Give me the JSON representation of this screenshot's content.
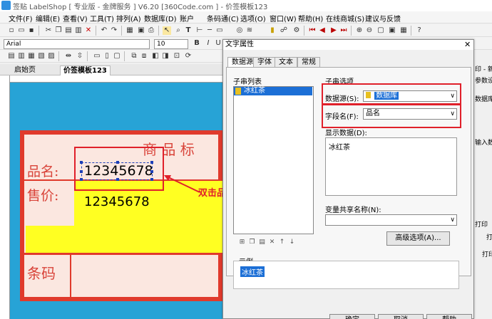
{
  "window": {
    "title": "签贴 LabelShop [ 专业版 - 金牌服务 ]  V6.20  [360Code.com ]  - 价签模板123"
  },
  "menu": [
    "文件(F)",
    "编辑(E)",
    "查看(V)",
    "工具(T)",
    "排列(A)",
    "数据库(D)",
    "账户",
    "条码通(C)",
    "选项(O)",
    "窗口(W)",
    "帮助(H)",
    "在线商城(S)",
    "建议与反馈"
  ],
  "font_toolbar": {
    "font": "Arial",
    "size": "10"
  },
  "tabs": [
    "启始页",
    "价签模板123"
  ],
  "label": {
    "title_text": "商 品 标",
    "name_label": "品名:",
    "price_label": "售价:",
    "barcode_label": "条码",
    "name_value": "12345678",
    "price_value": "12345678"
  },
  "annotation": {
    "double_click": "双击品名"
  },
  "right_panel": {
    "t1": "印 - 新",
    "t2": "参数设",
    "t3": "数据库",
    "t4": "输入数",
    "t5": "打印",
    "t6": "打",
    "t7": "打印"
  },
  "dialog": {
    "title": "文字属性",
    "tabs": [
      "数据源",
      "字体",
      "文本",
      "常规"
    ],
    "list_label": "子串列表",
    "list_items": [
      "冰红茶"
    ],
    "options_label": "子串选项",
    "datasource_label": "数据源(S):",
    "datasource_value": "数据库",
    "field_label": "字段名(F):",
    "field_value": "品名",
    "display_label": "显示数据(D):",
    "display_value": "冰红茶",
    "shared_label": "变量共享名称(N):",
    "advanced_button": "高级选项(A)...",
    "sample_label": "示例",
    "sample_value": "冰红茶",
    "buttons": {
      "ok": "确定",
      "cancel": "取消",
      "help": "帮助"
    }
  }
}
